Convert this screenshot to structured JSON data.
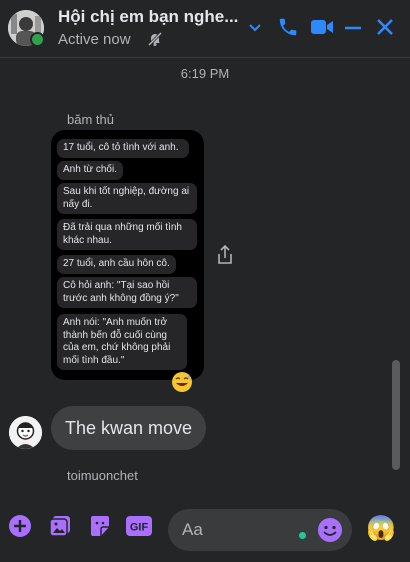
{
  "header": {
    "title": "Hội chị em bạn nghe...",
    "status": "Active now",
    "accent_color": "#2e89ff"
  },
  "chat": {
    "timestamp": "6:19 PM",
    "shared_post": {
      "sender": "băm thủ",
      "lines": [
        "17 tuổi, cô tỏ tình với anh.",
        "Anh từ chối.",
        "Sau khi tốt nghiệp, đường ai nấy đi.",
        "Đã trải qua những mối tình khác nhau.",
        "27 tuổi, anh cầu hôn cô.",
        "Cô hỏi anh: \"Tại sao hồi trước anh không đồng ý?\"",
        "Anh nói: \"Anh muốn trở thành bến đỗ cuối cùng của em, chứ không phải mối tình đầu.\""
      ],
      "reaction_icon": "grinning-sweat-emoji"
    },
    "message": {
      "text": "The kwan move"
    },
    "next_sender": "toimuonchet"
  },
  "composer": {
    "placeholder": "Aa",
    "icons": [
      "plus-icon",
      "image-icon",
      "sticker-icon",
      "gif-icon",
      "emoji-icon",
      "quick-reaction-emoji"
    ],
    "gif_label": "GIF",
    "quick_reaction": "😱"
  },
  "colors": {
    "background": "#242526",
    "bubble": "#3e4042",
    "accent": "#2e89ff",
    "composer_accent": "#a970ff"
  }
}
